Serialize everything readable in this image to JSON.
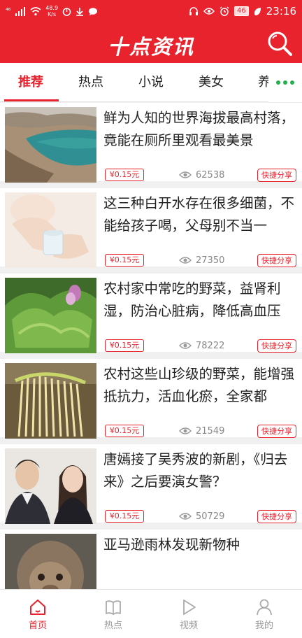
{
  "status_bar": {
    "signal": "⁴⁶",
    "speed_value": "48.9",
    "speed_unit": "K/s",
    "battery": "46",
    "time": "23:16"
  },
  "header": {
    "title": "十点资讯"
  },
  "tabs": [
    {
      "label": "推荐",
      "active": true
    },
    {
      "label": "热点",
      "active": false
    },
    {
      "label": "小说",
      "active": false
    },
    {
      "label": "美女",
      "active": false
    },
    {
      "label": "养",
      "active": false
    }
  ],
  "articles": [
    {
      "title": "鲜为人知的世界海拔最高村落，竟能在厕所里观看最美景",
      "price": "¥0.15元",
      "views": "62538",
      "share": "快捷分享"
    },
    {
      "title": "这三种白开水存在很多细菌，不能给孩子喝，父母别不当一",
      "price": "¥0.15元",
      "views": "27350",
      "share": "快捷分享"
    },
    {
      "title": "农村家中常吃的野菜，益肾利湿，防治心脏病，降低高血压",
      "price": "¥0.15元",
      "views": "78222",
      "share": "快捷分享"
    },
    {
      "title": "农村这些山珍级的野菜，能增强抵抗力，活血化瘀，全家都",
      "price": "¥0.15元",
      "views": "21549",
      "share": "快捷分享"
    },
    {
      "title": "唐嫣接了吴秀波的新剧，《归去来》之后要演女警？",
      "price": "¥0.15元",
      "views": "50729",
      "share": "快捷分享"
    },
    {
      "title": "亚马逊雨林发现新物种",
      "price": "",
      "views": "",
      "share": ""
    }
  ],
  "bottom_nav": [
    {
      "label": "首页",
      "icon": "home-icon",
      "active": true
    },
    {
      "label": "热点",
      "icon": "book-icon",
      "active": false
    },
    {
      "label": "视频",
      "icon": "play-icon",
      "active": false
    },
    {
      "label": "我的",
      "icon": "person-icon",
      "active": false
    }
  ],
  "colors": {
    "brand": "#e8232d",
    "accent_dots": "#22b14c"
  }
}
